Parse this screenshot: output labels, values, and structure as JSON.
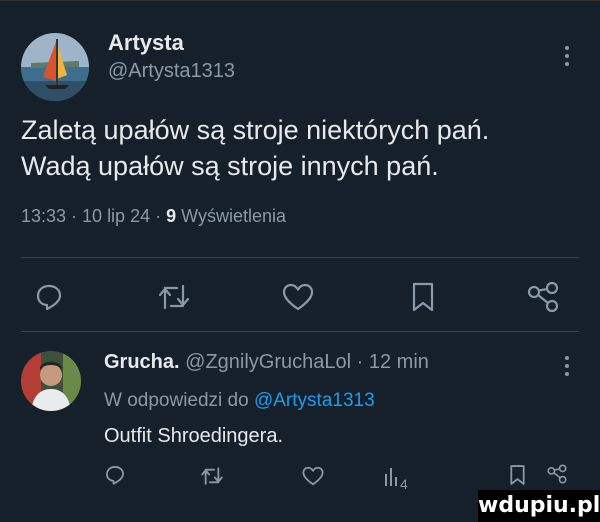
{
  "tweet": {
    "author_name": "Artysta",
    "author_handle": "@Artysta1313",
    "text_lines": [
      "Zaletą upałów są stroje niektórych pań.",
      "Wadą upałów są stroje innych pań."
    ],
    "time": "13:33 · 10 lip 24 · ",
    "views_count": "9",
    "views_label": " Wyświetlenia"
  },
  "actions": {
    "icons": [
      "reply-icon",
      "retweet-icon",
      "like-icon",
      "bookmark-icon",
      "share-icon"
    ]
  },
  "reply": {
    "author_name": "Grucha.",
    "author_handle": "@ZgnilyGruchaLol",
    "time": " · 12 min",
    "context_prefix": "W odpowiedzi do ",
    "context_link": "@Artysta1313",
    "text": "Outfit Shroedingera.",
    "views_count": "4"
  },
  "watermark": "wdupiu.pl",
  "colors": {
    "background": "#15202b",
    "text": "#e7e9ea",
    "muted": "#8b98a5",
    "link": "#1d9bf0",
    "divider": "#38444d"
  }
}
